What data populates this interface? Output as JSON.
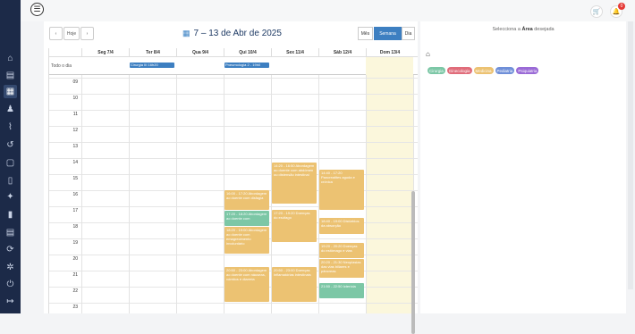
{
  "calendar": {
    "title": "7 – 13 de Abr de 2025",
    "today_label": "Hoje",
    "prev_label": "‹",
    "next_label": "›",
    "view_month": "Mês",
    "view_week": "Semana",
    "view_day": "Dia",
    "allday_label": "Todo o dia",
    "days": [
      "Seg 7/4",
      "Ter 8/4",
      "Qua 9/4",
      "Qui 10/4",
      "Sex 11/4",
      "Sáb 12/4",
      "Dom 13/4"
    ],
    "hours": [
      "09",
      "10",
      "11",
      "12",
      "13",
      "14",
      "15",
      "16",
      "17",
      "18",
      "19",
      "20",
      "21",
      "22",
      "23"
    ],
    "allday_events": [
      {
        "day": 1,
        "text": "Cirurgia III 16h20"
      },
      {
        "day": 3,
        "text": "Pneumologia 2 - 19h0"
      }
    ],
    "events": [
      {
        "day": 3,
        "start": 16.0,
        "end": 17.3,
        "cls": "medicina",
        "text": "16:00 - 17:20 Abordagem ao doente com disfagia"
      },
      {
        "day": 3,
        "start": 17.3,
        "end": 18.3,
        "cls": "cirurgia",
        "text": "17:20 - 18:20 Abordagem ao doente com"
      },
      {
        "day": 3,
        "start": 18.3,
        "end": 20.0,
        "cls": "medicina",
        "text": "18:20 - 19:00 Abordagem ao doente com emagrecimento involuntário"
      },
      {
        "day": 3,
        "start": 20.8,
        "end": 23.0,
        "cls": "medicina",
        "text": "20:50 - 23:00 Abordagem ao doente com náuseas, vómitos e diarreia"
      },
      {
        "day": 4,
        "start": 14.3,
        "end": 16.9,
        "cls": "medicina",
        "text": "14:20 - 16:50 Abordagem ao doente com abdómen ou distensão intestinal"
      },
      {
        "day": 4,
        "start": 17.2,
        "end": 19.3,
        "cls": "medicina",
        "text": "17:20 - 19:20 Doenças do esófago"
      },
      {
        "day": 4,
        "start": 20.8,
        "end": 23.0,
        "cls": "medicina",
        "text": "20:50 - 23:00 Doenças inflamatórias intestinais"
      },
      {
        "day": 5,
        "start": 14.7,
        "end": 17.3,
        "cls": "medicina",
        "text": "14:40 - 17:20 Pancreatites aguda e crónica"
      },
      {
        "day": 5,
        "start": 17.7,
        "end": 18.8,
        "cls": "medicina",
        "text": "18:40 - 19:00 Distúrbios da absorção"
      },
      {
        "day": 5,
        "start": 19.3,
        "end": 20.3,
        "cls": "medicina",
        "text": "19:20 - 20:20 Doenças do estômago e vias"
      },
      {
        "day": 5,
        "start": 20.3,
        "end": 21.5,
        "cls": "medicina",
        "text": "20:20 - 21:30 Neoplasias das vias biliares e pâncreas"
      },
      {
        "day": 5,
        "start": 21.8,
        "end": 22.8,
        "cls": "cirurgia",
        "text": "21:50 - 22:50 Icterícia"
      }
    ]
  },
  "right_panel": {
    "title_prefix": "Selecciona a",
    "title_bold": "Área",
    "title_suffix": "desejada",
    "tags": [
      {
        "label": "Cirurgia",
        "color": "#7cc7a6"
      },
      {
        "label": "Ginecologia",
        "color": "#e06c7a"
      },
      {
        "label": "Medicina",
        "color": "#ecc272"
      },
      {
        "label": "Pediatria",
        "color": "#6f8fd8"
      },
      {
        "label": "Psiquiatria",
        "color": "#9a6ad6"
      }
    ]
  },
  "topbar": {
    "notification_count": "0"
  },
  "sidebar_icons": [
    "home-icon",
    "id-card-icon",
    "calendar-icon",
    "user-edit-icon",
    "chart-icon",
    "history-icon",
    "note-icon",
    "file-search-icon",
    "pin-icon",
    "bookmark-icon",
    "card-icon",
    "sync-icon",
    "gear-icon",
    "power-icon",
    "logout-icon"
  ]
}
